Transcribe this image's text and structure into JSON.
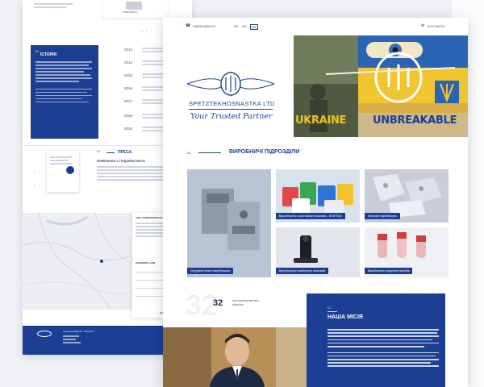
{
  "back": {
    "history_title": "ІСТОРІЯ",
    "years": [
      "2013",
      "2014",
      "2015",
      "2016",
      "2017",
      "2018",
      "2019"
    ],
    "press_num": "01.",
    "press_title": "ПРЕСА",
    "press_subtitle": "ПРИВІТАЄМО З ТРУДОВОЮ МІСТА",
    "card_caption": "РМБ 5266.Р1",
    "contacts_title": "ТОВ \"СПЕЦТЕХОСНАСТКА\"",
    "form_title": "НАПИШІТЬ НАМ",
    "send_label": "НАДІСЛАТИ",
    "footer_col1": "Спецтехоснастка",
    "footer_col2": "Контакти"
  },
  "front": {
    "phone": "+380504658714",
    "langs": [
      "EN",
      "RU",
      "UK"
    ],
    "contacts_label": "КОНТАКТИ",
    "logo_main": "SPETZTEKHOSNASTKA LTD",
    "logo_tagline": "Your Trusted Partner",
    "banner_text_a": "UKRAINE",
    "banner_text_b": "UNBREAKABLE",
    "sections": {
      "num": "01.",
      "title": "ВИРОБНИЧІ ПІДРОЗДІЛИ",
      "items": [
        {
          "label": "Інструментальне виробництво"
        },
        {
          "label": "Виробництво пластикових упаковок – ВТАРПАК"
        },
        {
          "label": "Пресове виробництво"
        },
        {
          "label": "Виробництво інженерних пластиків"
        },
        {
          "label": "Виробництво медичних виробів"
        }
      ]
    },
    "stat": {
      "big": "32",
      "num": "32",
      "text": "рік на ринку метало­обробки"
    },
    "mission": {
      "num": "02.",
      "title": "НАША МІСІЯ"
    }
  }
}
